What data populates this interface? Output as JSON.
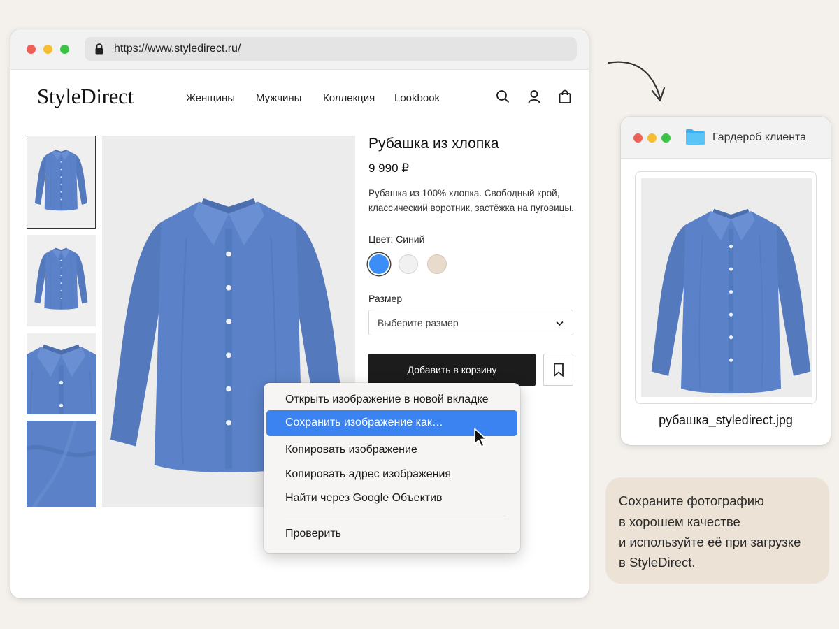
{
  "browser": {
    "url": "https://www.styledirect.ru/"
  },
  "site": {
    "logo": "StyleDirect",
    "nav": [
      "Женщины",
      "Мужчины",
      "Коллекция",
      "Lookbook"
    ],
    "icons": [
      "search-icon",
      "user-icon",
      "shopping-bag-icon"
    ]
  },
  "product": {
    "title": "Рубашка из хлопка",
    "price": "9 990 ₽",
    "description": [
      "Рубашка из 100% хлопка. Свободный крой,",
      "классический воротник, застёжка на пуговицы."
    ],
    "color_label": "Цвет: Синий",
    "colors": [
      "#3a8ef5",
      "#f1f1f1",
      "#e8dbcc"
    ],
    "selected_color": 0,
    "size_label": "Размер",
    "size_placeholder": "Выберите размер",
    "add_to_cart": "Добавить в корзину"
  },
  "context_menu": {
    "items": [
      "Открыть изображение в новой вкладке",
      "Сохранить изображение как…",
      "Копировать изображение",
      "Копировать адрес изображения",
      "Найти через Google Объектив",
      "Проверить"
    ],
    "highlighted": 1
  },
  "folder": {
    "title": "Гардероб клиента",
    "file_name": "рубашка_styledirect.jpg"
  },
  "tip": {
    "lines": [
      "Сохраните фотографию",
      "в хорошем качестве",
      "и используйте её при загрузке",
      "в StyleDirect."
    ]
  },
  "colors": {
    "accent": "#3a83f0",
    "shirt": "#5b82c8",
    "button_dark": "#1c1c1c"
  }
}
